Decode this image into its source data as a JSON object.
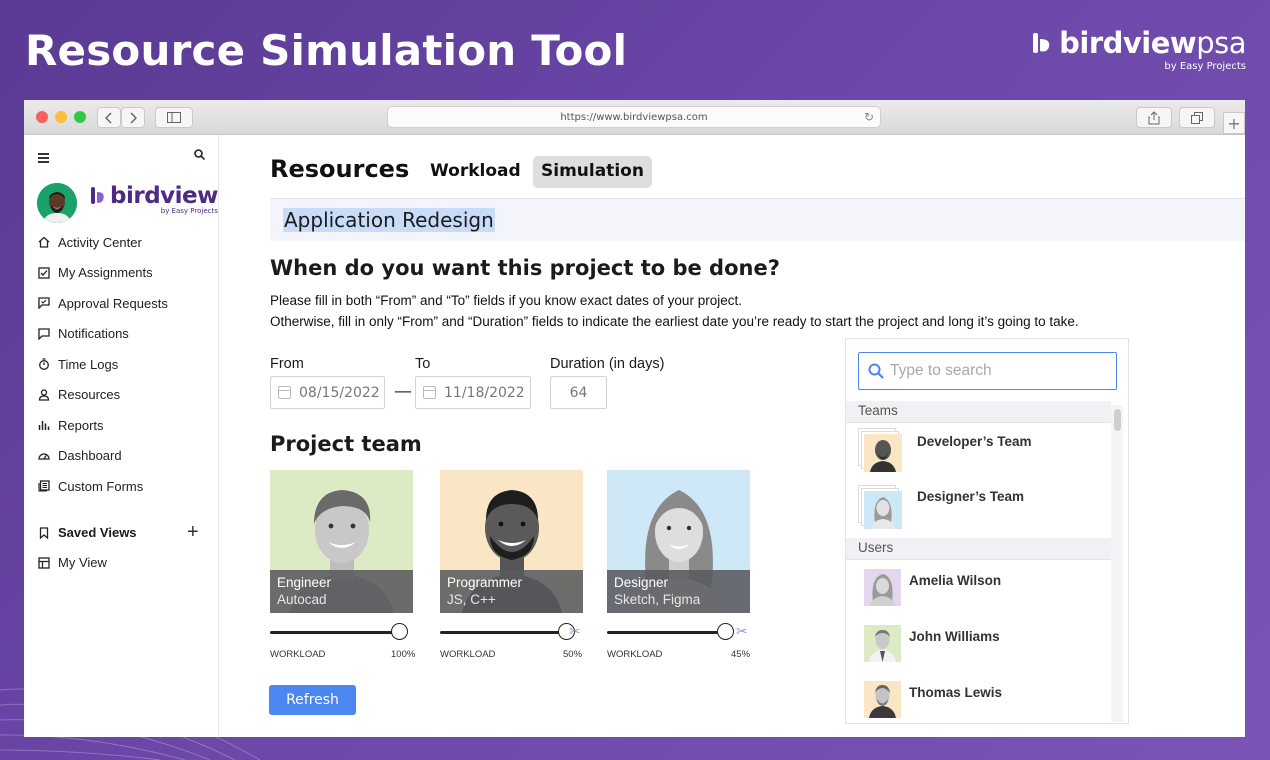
{
  "hero": {
    "title": "Resource Simulation Tool"
  },
  "brand": {
    "name_bold": "birdview",
    "name_light": "psa",
    "sub": "by Easy Projects"
  },
  "browser": {
    "url": "https://www.birdviewpsa.com"
  },
  "sidebar": {
    "brand_name": "birdview",
    "brand_sub": "by Easy Projects",
    "items": [
      {
        "label": "Activity Center",
        "icon": "home-icon"
      },
      {
        "label": "My Assignments",
        "icon": "checkbox-icon"
      },
      {
        "label": "Approval Requests",
        "icon": "approval-icon"
      },
      {
        "label": "Notifications",
        "icon": "bell-chat-icon"
      },
      {
        "label": "Time Logs",
        "icon": "stopwatch-icon"
      },
      {
        "label": "Resources",
        "icon": "person-icon"
      },
      {
        "label": "Reports",
        "icon": "bar-chart-icon"
      },
      {
        "label": "Dashboard",
        "icon": "gauge-icon"
      },
      {
        "label": "Custom Forms",
        "icon": "forms-icon"
      }
    ],
    "saved_views_label": "Saved Views",
    "saved_views": [
      {
        "label": "My View",
        "icon": "table-icon"
      }
    ]
  },
  "main": {
    "title": "Resources",
    "tabs": [
      {
        "label": "Workload",
        "active": false
      },
      {
        "label": "Simulation",
        "active": true
      }
    ],
    "project_name": "Application Redesign",
    "question": "When do you want this project to be done?",
    "desc_line1": "Please fill in both “From” and “To” fields if you know exact dates of your project.",
    "desc_line2": "Otherwise, fill in only “From” and “Duration” fields to indicate the earliest date you’re ready to start the project and long it’s going to take.",
    "from_label": "From",
    "from_value": "08/15/2022",
    "to_label": "To",
    "to_value": "11/18/2022",
    "duration_label": "Duration (in days)",
    "duration_value": "64",
    "team_title": "Project team",
    "team": [
      {
        "role": "Engineer",
        "skills": "Autocad",
        "workload_label": "WORKLOAD",
        "workload_text": "100%",
        "workload": 1.0,
        "bg": "#dcebc4"
      },
      {
        "role": "Programmer",
        "skills": "JS, C++",
        "workload_label": "WORKLOAD",
        "workload_text": "50%",
        "workload": 0.5,
        "bg": "#fae6c4"
      },
      {
        "role": "Designer",
        "skills": "Sketch, Figma",
        "workload_label": "WORKLOAD",
        "workload_text": "45%",
        "workload": 0.45,
        "bg": "#cfe8f8"
      }
    ],
    "refresh_label": "Refresh"
  },
  "panel": {
    "search_placeholder": "Type to search",
    "teams_header": "Teams",
    "teams": [
      {
        "name": "Developer’s Team"
      },
      {
        "name": "Designer’s Team"
      }
    ],
    "users_header": "Users",
    "users": [
      {
        "name": "Amelia Wilson"
      },
      {
        "name": "John Williams"
      },
      {
        "name": "Thomas Lewis"
      }
    ]
  },
  "colors": {
    "accent": "#4c86f0",
    "brand_purple": "#4e2a84",
    "background": "#6b47a8"
  }
}
